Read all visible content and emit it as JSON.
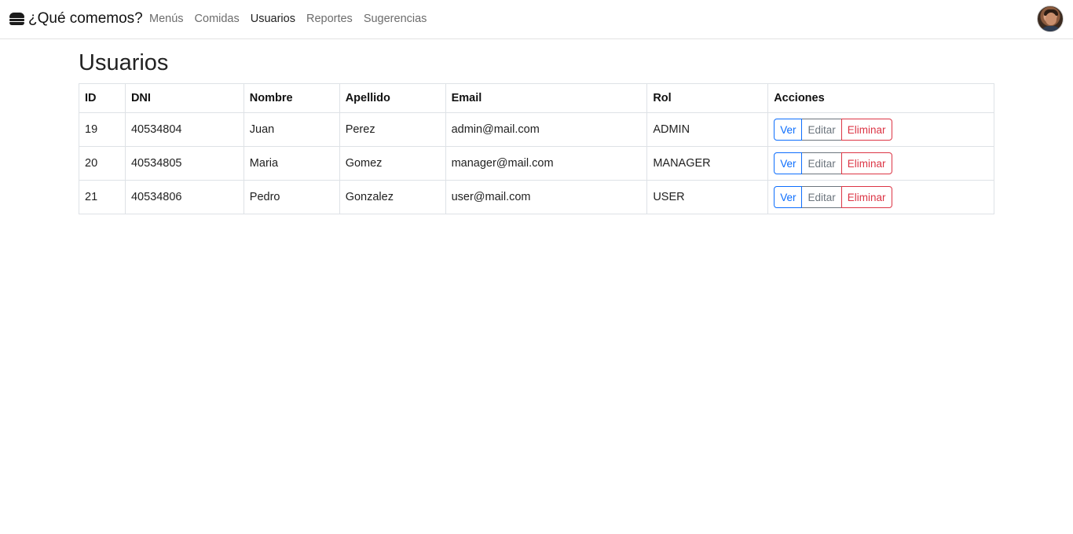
{
  "app": {
    "brand": "¿Qué comemos?",
    "brand_icon": "hamburger-icon"
  },
  "nav": {
    "items": [
      {
        "label": "Menús",
        "active": false
      },
      {
        "label": "Comidas",
        "active": false
      },
      {
        "label": "Usuarios",
        "active": true
      },
      {
        "label": "Reportes",
        "active": false
      },
      {
        "label": "Sugerencias",
        "active": false
      }
    ],
    "avatar_icon": "user-avatar"
  },
  "main": {
    "title": "Usuarios"
  },
  "table": {
    "headers": [
      "ID",
      "DNI",
      "Nombre",
      "Apellido",
      "Email",
      "Rol",
      "Acciones"
    ],
    "rows": [
      {
        "id": "19",
        "dni": "40534804",
        "nombre": "Juan",
        "apellido": "Perez",
        "email": "admin@mail.com",
        "rol": "ADMIN"
      },
      {
        "id": "20",
        "dni": "40534805",
        "nombre": "Maria",
        "apellido": "Gomez",
        "email": "manager@mail.com",
        "rol": "MANAGER"
      },
      {
        "id": "21",
        "dni": "40534806",
        "nombre": "Pedro",
        "apellido": "Gonzalez",
        "email": "user@mail.com",
        "rol": "USER"
      }
    ],
    "actions": {
      "ver": "Ver",
      "editar": "Editar",
      "eliminar": "Eliminar"
    }
  },
  "colors": {
    "primary": "#0d6efd",
    "secondary": "#6c757d",
    "danger": "#dc3545"
  }
}
